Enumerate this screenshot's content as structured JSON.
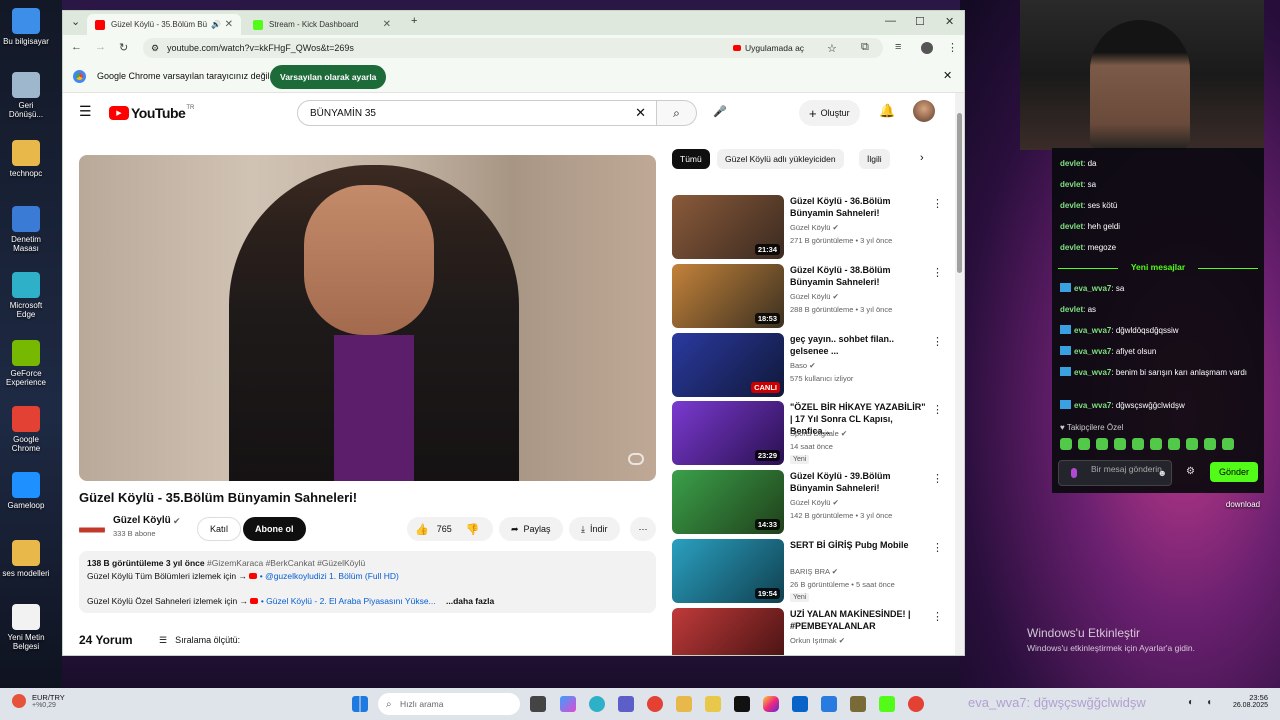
{
  "desktop": {
    "icons": [
      {
        "label": "Bu bilgisayar",
        "color": "#3c8ee8"
      },
      {
        "label": "Geri Dönüşü...",
        "color": "#9fb7cc"
      },
      {
        "label": "technopc",
        "color": "#e8b84a"
      },
      {
        "label": "Denetim Masası",
        "color": "#3a7bd5"
      },
      {
        "label": "Microsoft Edge",
        "color": "#2fb0c9"
      },
      {
        "label": "GeForce Experience",
        "color": "#76b900"
      },
      {
        "label": "Google Chrome",
        "color": "#e34133"
      },
      {
        "label": "Gameloop",
        "color": "#1e90ff"
      },
      {
        "label": "ses modelleri",
        "color": "#e8b84a"
      },
      {
        "label": "Yeni Metin Belgesi",
        "color": "#f2f2f2"
      }
    ],
    "right_icon_label": "download"
  },
  "browser": {
    "tabs": [
      {
        "title": "Güzel Köylü - 35.Bölüm Bü",
        "favicon_color": "#ff0000"
      },
      {
        "title": "Stream - Kick Dashboard",
        "favicon_color": "#53fc18"
      }
    ],
    "url": "youtube.com/watch?v=kkFHgF_QWos&t=269s",
    "open_in_app": "Uygulamada aç",
    "infobar_text": "Google Chrome varsayılan tarayıcınız değil",
    "infobar_button": "Varsayılan olarak ayarla"
  },
  "youtube": {
    "logo": "YouTube",
    "logo_country": "TR",
    "search_value": "BÜNYAMİN 35",
    "create_label": "Oluştur",
    "video": {
      "title": "Güzel Köylü - 35.Bölüm Bünyamin Sahneleri!",
      "channel": "Güzel Köylü",
      "subscribers": "333 B abone",
      "join": "Katıl",
      "subscribe": "Abone ol",
      "likes": "765",
      "share": "Paylaş",
      "download": "İndir",
      "views_line": "138 B görüntüleme  3 yıl önce",
      "hashtags": "#GizemKaraca #BerkCankat #GüzelKöylü",
      "desc_line1_a": "Güzel Köylü Tüm Bölümleri izlemek için →",
      "desc_line1_b": "• @guzelkoyludizi 1. Bölüm (Full HD)",
      "desc_line2_a": "Güzel Köylü Özel Sahneleri izlemek için →",
      "desc_line2_b": "• Güzel Köylü - 2. El Araba Piyasasını Yükse...",
      "more": "...daha fazla"
    },
    "comments_count": "24 Yorum",
    "sort_label": "Sıralama ölçütü:",
    "chips": [
      "Tümü",
      "Güzel Köylü adlı yükleyiciden",
      "İlgili"
    ],
    "related": [
      {
        "title": "Güzel Köylü - 36.Bölüm Bünyamin Sahneleri!",
        "channel": "Güzel Köylü",
        "meta": "271 B görüntüleme • 3 yıl önce",
        "duration": "21:34",
        "badge": "",
        "c1": "#8a5a3a",
        "c2": "#3a2a20"
      },
      {
        "title": "Güzel Köylü - 38.Bölüm Bünyamin Sahneleri!",
        "channel": "Güzel Köylü",
        "meta": "288 B görüntüleme • 3 yıl önce",
        "duration": "18:53",
        "badge": "",
        "c1": "#c4823a",
        "c2": "#3a3020"
      },
      {
        "title": "geç yayın.. sohbet filan.. gelsenee ...",
        "channel": "Baso",
        "meta": "575 kullanıcı izliyor",
        "duration": "CANLI",
        "badge": "",
        "c1": "#2a3aa0",
        "c2": "#101838"
      },
      {
        "title": "\"ÖZEL BİR HİKAYE YAZABİLİR\" | 17 Yıl Sonra CL Kapısı, Benfica...",
        "channel": "Sports Digitale",
        "meta": "14 saat önce",
        "duration": "23:29",
        "badge": "Yeni",
        "c1": "#7a3ad0",
        "c2": "#2a1050"
      },
      {
        "title": "Güzel Köylü - 39.Bölüm Bünyamin Sahneleri!",
        "channel": "Güzel Köylü",
        "meta": "142 B görüntüleme • 3 yıl önce",
        "duration": "14:33",
        "badge": "",
        "c1": "#3aa04a",
        "c2": "#20401a"
      },
      {
        "title": "SERT Bİ GİRİŞ Pubg Mobile",
        "channel": "BARIŞ BRA",
        "meta": "26 B görüntüleme • 5 saat önce",
        "duration": "19:54",
        "badge": "Yeni",
        "c1": "#2aa0c0",
        "c2": "#104050"
      },
      {
        "title": "UZİ YALAN MAKİNESİNDE! | #PEMBEYALANLAR",
        "channel": "Orkun Işıtmak",
        "meta": "",
        "duration": "",
        "badge": "",
        "c1": "#c03a3a",
        "c2": "#401010"
      }
    ]
  },
  "chat": {
    "old_messages": [
      {
        "user": "devlet",
        "text": "da",
        "badge": false
      },
      {
        "user": "devlet",
        "text": "sa",
        "badge": false
      },
      {
        "user": "devlet",
        "text": "ses kötü",
        "badge": false
      },
      {
        "user": "devlet",
        "text": "heh geldi",
        "badge": false
      },
      {
        "user": "devlet",
        "text": "megoze",
        "badge": false
      }
    ],
    "new_label": "Yeni mesajlar",
    "new_messages": [
      {
        "user": "eva_wva7",
        "text": "sa",
        "badge": true
      },
      {
        "user": "devlet",
        "text": "as",
        "badge": false
      },
      {
        "user": "eva_wva7",
        "text": "dğwldöqsdğqssiw",
        "badge": true
      },
      {
        "user": "eva_wva7",
        "text": "afiyet olsun",
        "badge": true
      },
      {
        "user": "eva_wva7",
        "text": "benim bi sarışın karı anlaşmam vardı",
        "badge": true
      },
      {
        "user": "eva_wva7",
        "text": "dğwsçswğğclwidşw",
        "badge": true
      }
    ],
    "followers_only": "Takipçilere Özel",
    "input_placeholder": "Bir mesaj gönderin",
    "send_label": "Gönder",
    "accent": "#53fc18"
  },
  "activate_windows": {
    "title": "Windows'u Etkinleştir",
    "subtitle": "Windows'u etkinleştirmek için Ayarlar'a gidin."
  },
  "taskbar": {
    "ticker_name": "EUR/TRY",
    "ticker_value": "+%0,29",
    "search_placeholder": "Hızlı arama",
    "tray_overlay": "eva_wva7: dğwşçswğğclwidşw",
    "time": "23:56",
    "date": "26.08.2025"
  }
}
